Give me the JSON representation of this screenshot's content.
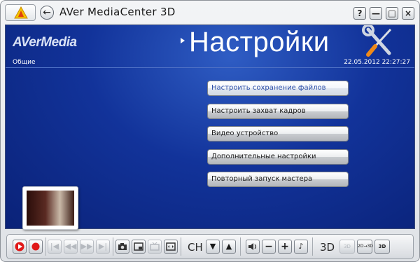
{
  "window": {
    "title": "AVer MediaCenter 3D",
    "controls": {
      "help": "?",
      "minimize": "—",
      "maximize": "□",
      "close": "×"
    }
  },
  "header": {
    "brand": "AVerMedia",
    "page_title": "Настройки",
    "section": "Общие",
    "datetime": "22.05.2012 22:27:27"
  },
  "menu": {
    "items": [
      {
        "label": "Настроить сохранение файлов"
      },
      {
        "label": "Настроить захват кадров"
      },
      {
        "label": "Видео устройство"
      },
      {
        "label": "Дополнительные настройки"
      },
      {
        "label": "Повторный запуск мастера"
      }
    ]
  },
  "toolbar": {
    "ch_label": "CH",
    "threed_label": "3D",
    "threed_btn_a": "3D",
    "threed_btn_b": "2D→3D",
    "threed_btn_c": "3D"
  },
  "colors": {
    "content_bg": "#12339a",
    "active_item_text": "#2d4fa8",
    "record_red": "#e01818"
  }
}
